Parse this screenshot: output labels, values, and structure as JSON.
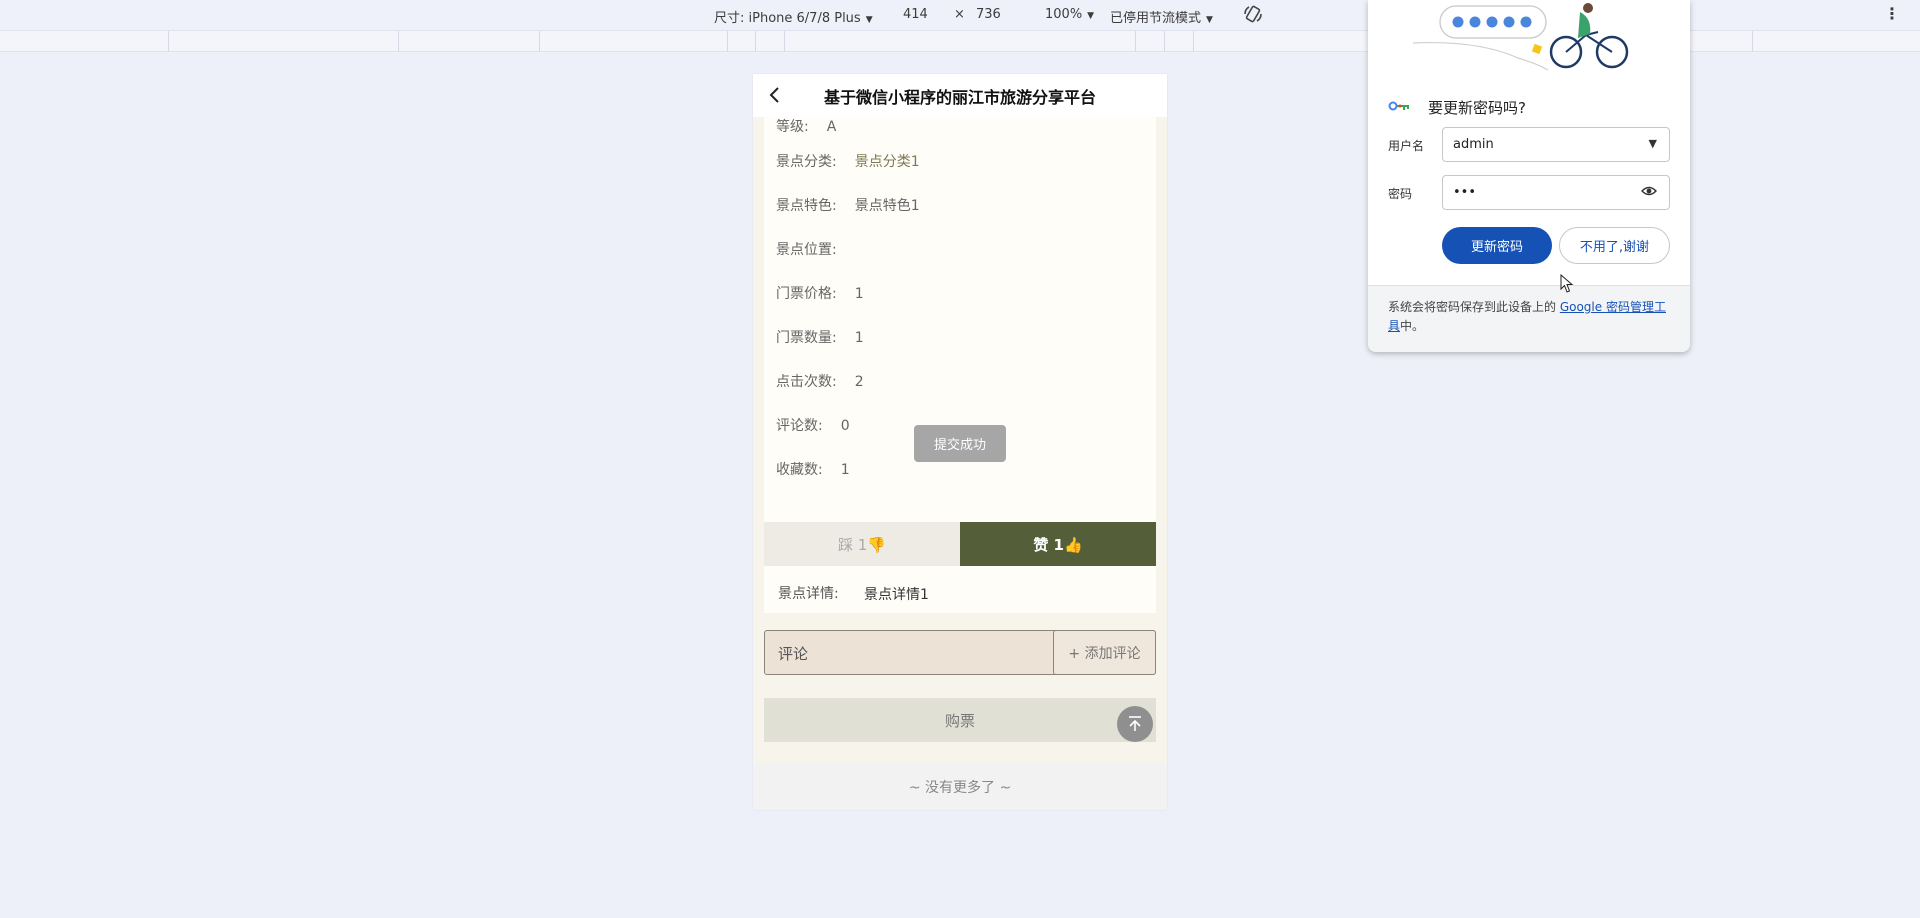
{
  "devtools": {
    "device_label": "尺寸: iPhone 6/7/8 Plus",
    "width": "414",
    "times": "×",
    "height": "736",
    "zoom": "100%",
    "throttle": "已停用节流模式"
  },
  "app": {
    "title": "基于微信小程序的丽江市旅游分享平台",
    "info_rows": [
      {
        "label": "等级:",
        "value": "A"
      },
      {
        "label": "景点分类:",
        "value": "景点分类1"
      },
      {
        "label": "景点特色:",
        "value": "景点特色1"
      },
      {
        "label": "景点位置:",
        "value": ""
      },
      {
        "label": "门票价格:",
        "value": "1"
      },
      {
        "label": "门票数量:",
        "value": "1"
      },
      {
        "label": "点击次数:",
        "value": "2"
      },
      {
        "label": "评论数:",
        "value": "0"
      },
      {
        "label": "收藏数:",
        "value": "1"
      }
    ],
    "toast": "提交成功",
    "dislike_label": "踩 1👎",
    "like_label": "赞 1👍",
    "detail_label": "景点详情:",
    "detail_value": "景点详情1",
    "comment_label": "评论",
    "add_comment_label": "+ 添加评论",
    "buy_label": "购票",
    "footer": "~ 没有更多了 ~"
  },
  "password_popup": {
    "title": "要更新密码吗?",
    "username_label": "用户名",
    "username_value": "admin",
    "password_label": "密码",
    "password_value": "•••",
    "update_button": "更新密码",
    "dismiss_button": "不用了,谢谢",
    "footer_text": "系统会将密码保存到此设备上的 ",
    "footer_link": "Google 密码管理工具",
    "footer_end": "中。"
  },
  "colors": {
    "like": "#545e39",
    "primary_blue": "#1652b6"
  }
}
